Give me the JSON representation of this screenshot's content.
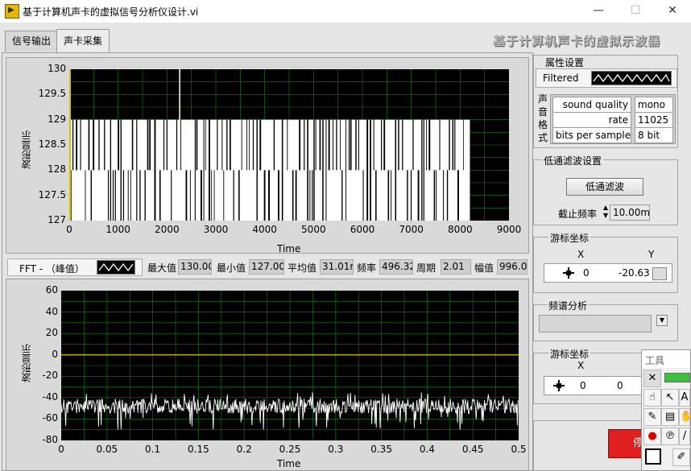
{
  "window": {
    "title": "基于计算机声卡的虚拟信号分析仪设计.vi",
    "minimize_glyph": "—",
    "maximize_glyph": "☐",
    "close_glyph": "✕"
  },
  "tabs": [
    {
      "label": "信号输出",
      "selected": false
    },
    {
      "label": "声卡采集",
      "selected": true
    }
  ],
  "banner": "基于计算机声卡的虚拟示波器",
  "waveform_graph": {
    "ylabel": "波形显示",
    "xlabel": "Time",
    "y_ticks": [
      "130",
      "129.5",
      "129",
      "128.5",
      "128",
      "127.5",
      "127"
    ],
    "x_ticks": [
      "0",
      "1000",
      "2000",
      "3000",
      "4000",
      "5000",
      "6000",
      "7000",
      "8000",
      "9000"
    ]
  },
  "stats_bar": {
    "mode_label": "FFT - （峰值）",
    "max_label": "最大值",
    "max_value": "130.00",
    "min_label": "最小值",
    "min_value": "127.00",
    "mean_label": "平均值",
    "mean_value": "31.01m",
    "freq_label": "频率",
    "freq_value": "496.32",
    "period_label": "周期",
    "period_value": "2.01",
    "amp_label": "幅值",
    "amp_value": "996.0"
  },
  "spectrum_graph": {
    "ylabel": "波形显示",
    "xlabel": "Time",
    "y_ticks": [
      "60",
      "40",
      "20",
      "0",
      "-20",
      "-40",
      "-60",
      "-80"
    ],
    "x_ticks": [
      "0",
      "0.05",
      "0.1",
      "0.15",
      "0.2",
      "0.25",
      "0.3",
      "0.35",
      "0.4",
      "0.45",
      "0.5"
    ]
  },
  "chart_data": [
    {
      "type": "line",
      "title": "",
      "xlabel": "Time",
      "ylabel": "波形显示",
      "xlim": [
        0,
        9000
      ],
      "ylim": [
        127,
        130
      ],
      "grid": true,
      "series": [
        {
          "values_description_range": [
            127,
            130
          ],
          "x_extent": [
            0,
            8200
          ],
          "levels": [
            127,
            128,
            129,
            130
          ]
        }
      ]
    },
    {
      "type": "line",
      "title": "",
      "xlabel": "Time",
      "ylabel": "波形显示",
      "xlim": [
        0,
        0.5
      ],
      "ylim": [
        -80,
        60
      ],
      "grid": true,
      "series": [
        {
          "x_extent": [
            0,
            0.5
          ],
          "mean": -48,
          "min": -70,
          "max": -35
        }
      ],
      "reference_line_y": 0
    }
  ],
  "properties": {
    "title": "属性设置",
    "filter_label": "Filtered",
    "sound_format_label": [
      "声",
      "音",
      "格",
      "式"
    ],
    "rows": [
      {
        "name": "sound quality",
        "value": "mono"
      },
      {
        "name": "rate",
        "value": "11025"
      },
      {
        "name": "bits per sample",
        "value": "8 bit"
      }
    ]
  },
  "lowpass": {
    "title": "低通滤波设置",
    "button_label": "低通滤波",
    "cutoff_label": "截止频率",
    "cutoff_value": "10.00m"
  },
  "cursor1": {
    "title": "游标坐标",
    "x_label": "X",
    "y_label": "Y",
    "x_value": "0",
    "y_value": "-20.63"
  },
  "spectrum_analysis": {
    "title": "频谱分析"
  },
  "cursor2": {
    "title": "游标坐标",
    "x_label": "X",
    "x_value": "0",
    "y_value": "0"
  },
  "tools_palette": {
    "title": "工具"
  },
  "stop_button": {
    "label": "停"
  },
  "colors": {
    "plot_bg": "#000000",
    "grid": "#1f7a1f",
    "waveform": "#ffffff",
    "reference": "#d4c400",
    "stop_button": "#e02020"
  }
}
